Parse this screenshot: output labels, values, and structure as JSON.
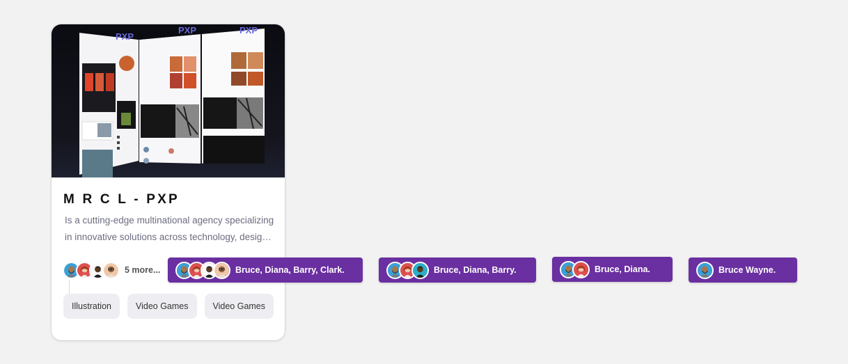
{
  "card": {
    "title": "M R C L - PXP",
    "description": "Is a cutting-edge multinational agency specializing in innovative  solutions across technology, design and digital experiences.",
    "thumbnail_logo": "PXP",
    "more_label": "5 more...",
    "tags": [
      "Illustration",
      "Video Games",
      "Video Games"
    ],
    "avatar_icons": [
      "avatar-bald-beard-icon",
      "avatar-red-hair-icon",
      "avatar-dark-skin-icon",
      "avatar-glasses-icon"
    ]
  },
  "pills": [
    {
      "label": "Bruce, Diana, Barry, Clark.",
      "avatars": 4
    },
    {
      "label": "Bruce, Diana, Barry.",
      "avatars": 3
    },
    {
      "label": "Bruce, Diana.",
      "avatars": 2
    },
    {
      "label": "Bruce Wayne.",
      "avatars": 1
    }
  ],
  "colors": {
    "pill_bg": "#6a2fa0",
    "avatar_blue": "#3aa0d8",
    "avatar_red": "#e05050",
    "avatar_teal": "#2bb0c8",
    "avatar_peach": "#f0c8a8"
  }
}
